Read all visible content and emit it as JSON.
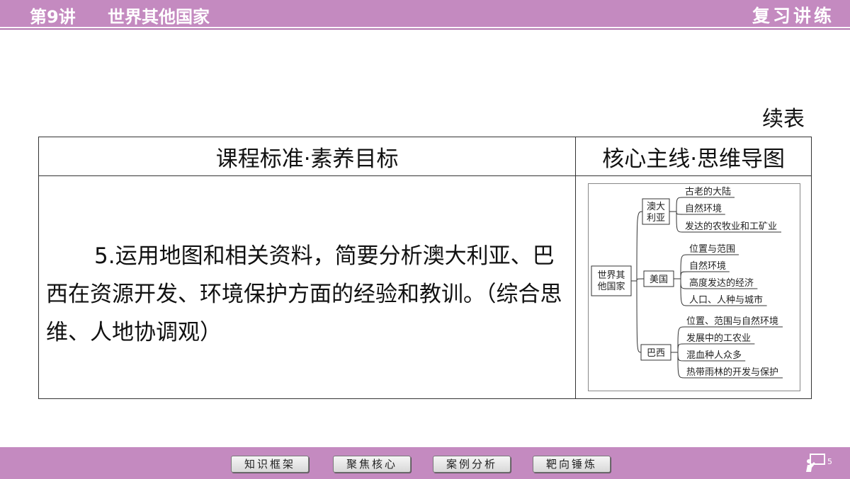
{
  "header": {
    "lecture": "第9讲",
    "title": "世界其他国家",
    "section": "复习讲练"
  },
  "continued_label": "续表",
  "table": {
    "col1_header": "课程标准·素养目标",
    "col2_header": "核心主线·思维导图",
    "standard_text": "5.运用地图和相关资料，简要分析澳大利亚、巴西在资源开发、环境保护方面的经验和教训。（综合思维、人地协调观）"
  },
  "mindmap": {
    "root": "世界其他国家",
    "root_lines": [
      "世界其",
      "他国家"
    ],
    "branches": [
      {
        "name": "澳大利亚",
        "name_lines": [
          "澳大",
          "利亚"
        ],
        "items": [
          "古老的大陆",
          "自然环境",
          "发达的农牧业和工矿业"
        ]
      },
      {
        "name": "美国",
        "name_lines": [
          "美国"
        ],
        "items": [
          "位置与范围",
          "自然环境",
          "高度发达的经济",
          "人口、人种与城市"
        ]
      },
      {
        "name": "巴西",
        "name_lines": [
          "巴西"
        ],
        "items": [
          "位置、范围与自然环境",
          "发展中的工农业",
          "混血种人众多",
          "热带雨林的开发与保护"
        ]
      }
    ]
  },
  "nav": {
    "buttons": [
      "知识框架",
      "聚焦核心",
      "案例分析",
      "靶向锤炼"
    ]
  },
  "page_number": "5",
  "colors": {
    "bar": "#c48ac0",
    "text": "#111111"
  }
}
